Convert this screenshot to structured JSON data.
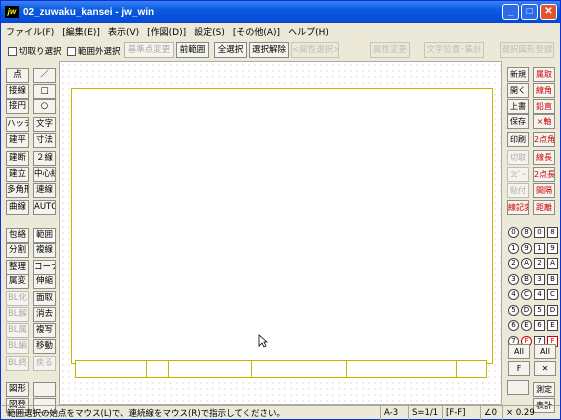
{
  "window": {
    "title": "02_zuwaku_kansei - jw_win",
    "app_icon": "jw",
    "min": "_",
    "max": "□",
    "close": "✕"
  },
  "menu": [
    "ファイル(F)",
    "[編集(E)]",
    "表示(V)",
    "[作図(D)]",
    "設定(S)",
    "[その他(A)]",
    "ヘルプ(H)"
  ],
  "toolbar": {
    "chk1": "切取り選択",
    "chk2": "範囲外選択",
    "b_kijun": "基準点変更",
    "b_zen": "前範囲",
    "b_all": "全選択",
    "b_kaijo": "選択解除",
    "b_zokusei": "<属性選択>",
    "b_zokuseihenko": "属性変更",
    "b_moji": "文字位置･集計",
    "b_sentaku": "選択図形登録"
  },
  "left_tools": [
    [
      "点",
      "／"
    ],
    [
      "接線",
      "□"
    ],
    [
      "接円",
      "○"
    ],
    [
      "ハッチ",
      "文字"
    ],
    [
      "建平",
      "寸法"
    ],
    [
      "建断",
      "２線"
    ],
    [
      "建立",
      "中心線"
    ],
    [
      "多角形",
      "連線"
    ],
    [
      "曲線",
      "AUTO"
    ],
    [
      "包絡",
      "範囲"
    ],
    [
      "分割",
      "複線"
    ],
    [
      "整理",
      "コーナー"
    ],
    [
      "属変",
      "伸縮"
    ],
    [
      "BL化",
      "面取"
    ],
    [
      "BL解",
      "消去"
    ],
    [
      "BL属",
      "複写"
    ],
    [
      "BL編",
      "移動"
    ],
    [
      "BL終",
      "戻る"
    ],
    [
      "図形",
      ""
    ],
    [
      "図登",
      ""
    ]
  ],
  "right_tools": [
    [
      "新規",
      "属取"
    ],
    [
      "開く",
      "線角"
    ],
    [
      "上書",
      "鉛直"
    ],
    [
      "保存",
      "×軸"
    ],
    [
      "印刷",
      "2点角"
    ],
    [
      "切取",
      "線長"
    ],
    [
      "ｺﾋﾟｰ",
      "2点長"
    ],
    [
      "貼付",
      "間隔"
    ],
    [
      "線記変",
      "距離"
    ]
  ],
  "layers": {
    "rows": [
      [
        "0",
        "8",
        "0",
        "8"
      ],
      [
        "1",
        "9",
        "1",
        "9"
      ],
      [
        "2",
        "A",
        "2",
        "A"
      ],
      [
        "3",
        "B",
        "3",
        "B"
      ],
      [
        "4",
        "C",
        "4",
        "C"
      ],
      [
        "5",
        "D",
        "5",
        "D"
      ],
      [
        "6",
        "E",
        "6",
        "E"
      ],
      [
        "7",
        "F",
        "7",
        "F"
      ]
    ],
    "all_left": "All",
    "all_right": "All",
    "f_left": "F",
    "f_right": "✕"
  },
  "right_bottom": {
    "b1": "",
    "b2": "測定",
    "b3": "表計"
  },
  "status": {
    "message": "範囲選択の始点をマウス(L)で、連続線をマウス(R)で指示してください。",
    "paper": "A-3",
    "scale": "S=1/1",
    "layer": "[F-F]",
    "angle": "∠0",
    "zoom": "× 0.29"
  },
  "colors": {
    "title_bar": "#0a5be0",
    "frame": "#c8b400",
    "bg": "#ece9d8"
  }
}
